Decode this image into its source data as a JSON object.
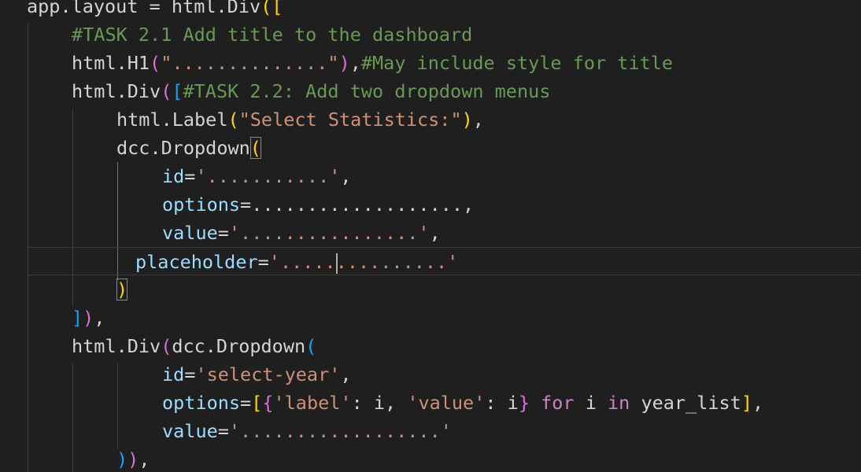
{
  "editor": {
    "lines": [
      {
        "tokens": [
          [
            "plain",
            "app.layout = html.Div"
          ],
          [
            "b1",
            "(["
          ]
        ]
      },
      {
        "tokens": [
          [
            "cm",
            "#TASK 2.1 Add title to the dashboard"
          ]
        ]
      },
      {
        "tokens": [
          [
            "plain",
            "html.H1"
          ],
          [
            "b2",
            "("
          ],
          [
            "str",
            "\"..............\""
          ],
          [
            "b2",
            ")"
          ],
          [
            "plain",
            ","
          ],
          [
            "cm",
            "#May include style for title"
          ]
        ]
      },
      {
        "tokens": [
          [
            "plain",
            "html.Div"
          ],
          [
            "b2",
            "("
          ],
          [
            "b3",
            "["
          ],
          [
            "cm",
            "#TASK 2.2: Add two dropdown menus"
          ]
        ]
      },
      {
        "tokens": [
          [
            "plain",
            "html.Label"
          ],
          [
            "b1",
            "("
          ],
          [
            "str",
            "\"Select Statistics:\""
          ],
          [
            "b1",
            ")"
          ],
          [
            "plain",
            ","
          ]
        ]
      },
      {
        "tokens": [
          [
            "plain",
            "dcc.Dropdown"
          ],
          [
            "b1",
            "("
          ]
        ]
      },
      {
        "tokens": [
          [
            "var",
            "id"
          ],
          [
            "plain",
            "="
          ],
          [
            "str",
            "'...........'"
          ],
          [
            "plain",
            ","
          ]
        ]
      },
      {
        "tokens": [
          [
            "var",
            "options"
          ],
          [
            "plain",
            "=...................,"
          ]
        ]
      },
      {
        "tokens": [
          [
            "var",
            "value"
          ],
          [
            "plain",
            "="
          ],
          [
            "str",
            "'................'"
          ],
          [
            "plain",
            ","
          ]
        ]
      },
      {
        "tokens": [
          [
            "var",
            "placeholder"
          ],
          [
            "plain",
            "="
          ],
          [
            "str",
            "'.....|..........'"
          ]
        ]
      },
      {
        "tokens": [
          [
            "b1",
            ")"
          ]
        ]
      },
      {
        "tokens": [
          [
            "b3",
            "]"
          ],
          [
            "b2",
            ")"
          ],
          [
            "plain",
            ","
          ]
        ]
      },
      {
        "tokens": [
          [
            "plain",
            "html.Div"
          ],
          [
            "b2",
            "("
          ],
          [
            "plain",
            "dcc.Dropdown"
          ],
          [
            "b3",
            "("
          ]
        ]
      },
      {
        "tokens": [
          [
            "var",
            "id"
          ],
          [
            "plain",
            "="
          ],
          [
            "str",
            "'select-year'"
          ],
          [
            "plain",
            ","
          ]
        ]
      },
      {
        "tokens": [
          [
            "var",
            "options"
          ],
          [
            "plain",
            "="
          ],
          [
            "b1",
            "["
          ],
          [
            "b2",
            "{"
          ],
          [
            "str",
            "'label'"
          ],
          [
            "plain",
            ": i, "
          ],
          [
            "str",
            "'value'"
          ],
          [
            "plain",
            ": i"
          ],
          [
            "b2",
            "}"
          ],
          [
            "kw",
            " for "
          ],
          [
            "plain",
            "i"
          ],
          [
            "kw",
            " in "
          ],
          [
            "plain",
            "year_list"
          ],
          [
            "b1",
            "]"
          ],
          [
            "plain",
            ","
          ]
        ]
      },
      {
        "tokens": [
          [
            "var",
            "value"
          ],
          [
            "plain",
            "="
          ],
          [
            "str",
            "'..................'"
          ]
        ]
      },
      {
        "tokens": [
          [
            "b3",
            ")"
          ],
          [
            "b2",
            ")"
          ],
          [
            "plain",
            ","
          ]
        ]
      }
    ]
  }
}
